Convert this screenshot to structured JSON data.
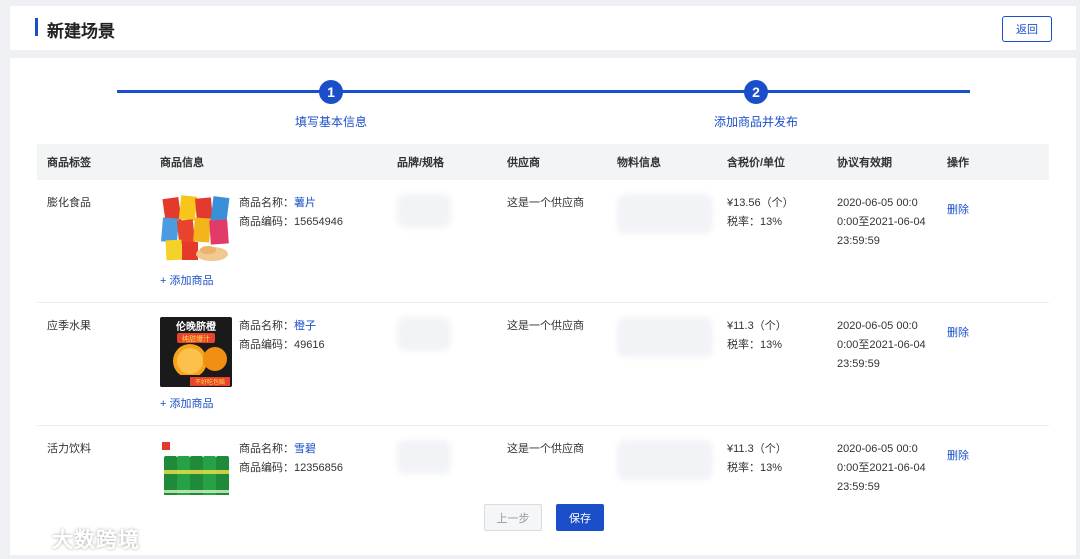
{
  "header": {
    "title": "新建场景",
    "back_label": "返回"
  },
  "steps": [
    {
      "number": "1",
      "label": "填写基本信息"
    },
    {
      "number": "2",
      "label": "添加商品并发布"
    }
  ],
  "table": {
    "columns": [
      "商品标签",
      "商品信息",
      "品牌/规格",
      "供应商",
      "物料信息",
      "含税价/单位",
      "协议有效期",
      "操作"
    ],
    "rows": [
      {
        "tag": "膨化食品",
        "name_label": "商品名称：",
        "name": "薯片",
        "code_label": "商品编码：",
        "code": "15654946",
        "add_label": "+ 添加商品",
        "supplier": "这是一个供应商",
        "price": "¥13.56（个）",
        "tax": "税率：13%",
        "validity_1": "2020-06-05 00:0",
        "validity_2": "0:00至2021-06-04",
        "validity_3": "23:59:59",
        "action": "删除"
      },
      {
        "tag": "应季水果",
        "name_label": "商品名称：",
        "name": "橙子",
        "code_label": "商品编码：",
        "code": "49616",
        "add_label": "+ 添加商品",
        "supplier": "这是一个供应商",
        "price": "¥11.3（个）",
        "tax": "税率：13%",
        "validity_1": "2020-06-05 00:0",
        "validity_2": "0:00至2021-06-04",
        "validity_3": "23:59:59",
        "action": "删除",
        "image_text_top": "伦晚脐橙",
        "image_text_mid": "纯甜爆汁",
        "image_text_bottom": "不好吃包赔"
      },
      {
        "tag": "活力饮料",
        "name_label": "商品名称：",
        "name": "雪碧",
        "code_label": "商品编码：",
        "code": "12356856",
        "supplier": "这是一个供应商",
        "price": "¥11.3（个）",
        "tax": "税率：13%",
        "validity_1": "2020-06-05 00:0",
        "validity_2": "0:00至2021-06-04",
        "validity_3": "23:59:59",
        "action": "删除"
      }
    ]
  },
  "footer": {
    "prev_label": "上一步",
    "save_label": "保存"
  },
  "watermark": {
    "text": "大数跨境"
  },
  "colors": {
    "accent": "#1a4fc9",
    "page_bg": "#eef0f4",
    "header_bg": "#f3f4f6"
  }
}
